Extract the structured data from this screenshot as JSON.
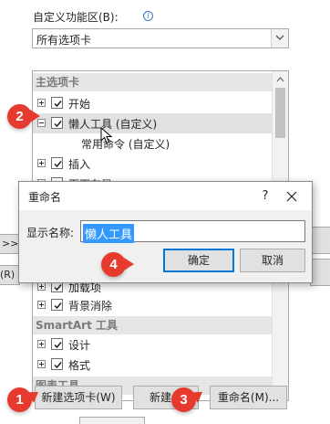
{
  "customize": {
    "label": "自定义功能区(B):",
    "dropdown_value": "所有选项卡"
  },
  "tree": {
    "group_main": "主选项卡",
    "item_start": "开始",
    "item_lazy": "懒人工具 (自定义)",
    "item_common": "常用命令 (自定义)",
    "item_insert": "插入",
    "item_layout": "页面布局",
    "item_addins": "加载项",
    "item_bgremove": "背景消除",
    "group_smartart": "SmartArt 工具",
    "item_design": "设计",
    "item_format": "格式",
    "group_chart": "图表工具"
  },
  "side": {
    "left_frag": "(R)"
  },
  "dialog": {
    "title": "重命名",
    "help": "?",
    "display_label": "显示名称:",
    "name_value": "懒人工具",
    "ok_label": "确定",
    "cancel_label": "取消"
  },
  "bottom": {
    "new_tab": "新建选项卡(W)",
    "new_group": "新建组",
    "rename": "重命名(M)..."
  },
  "badges": {
    "b1": "1",
    "b2": "2",
    "b3": "3",
    "b4": "4"
  },
  "colors": {
    "badge": "#e63a2e",
    "selection": "#3399ff",
    "primary_border": "#0078d7"
  }
}
